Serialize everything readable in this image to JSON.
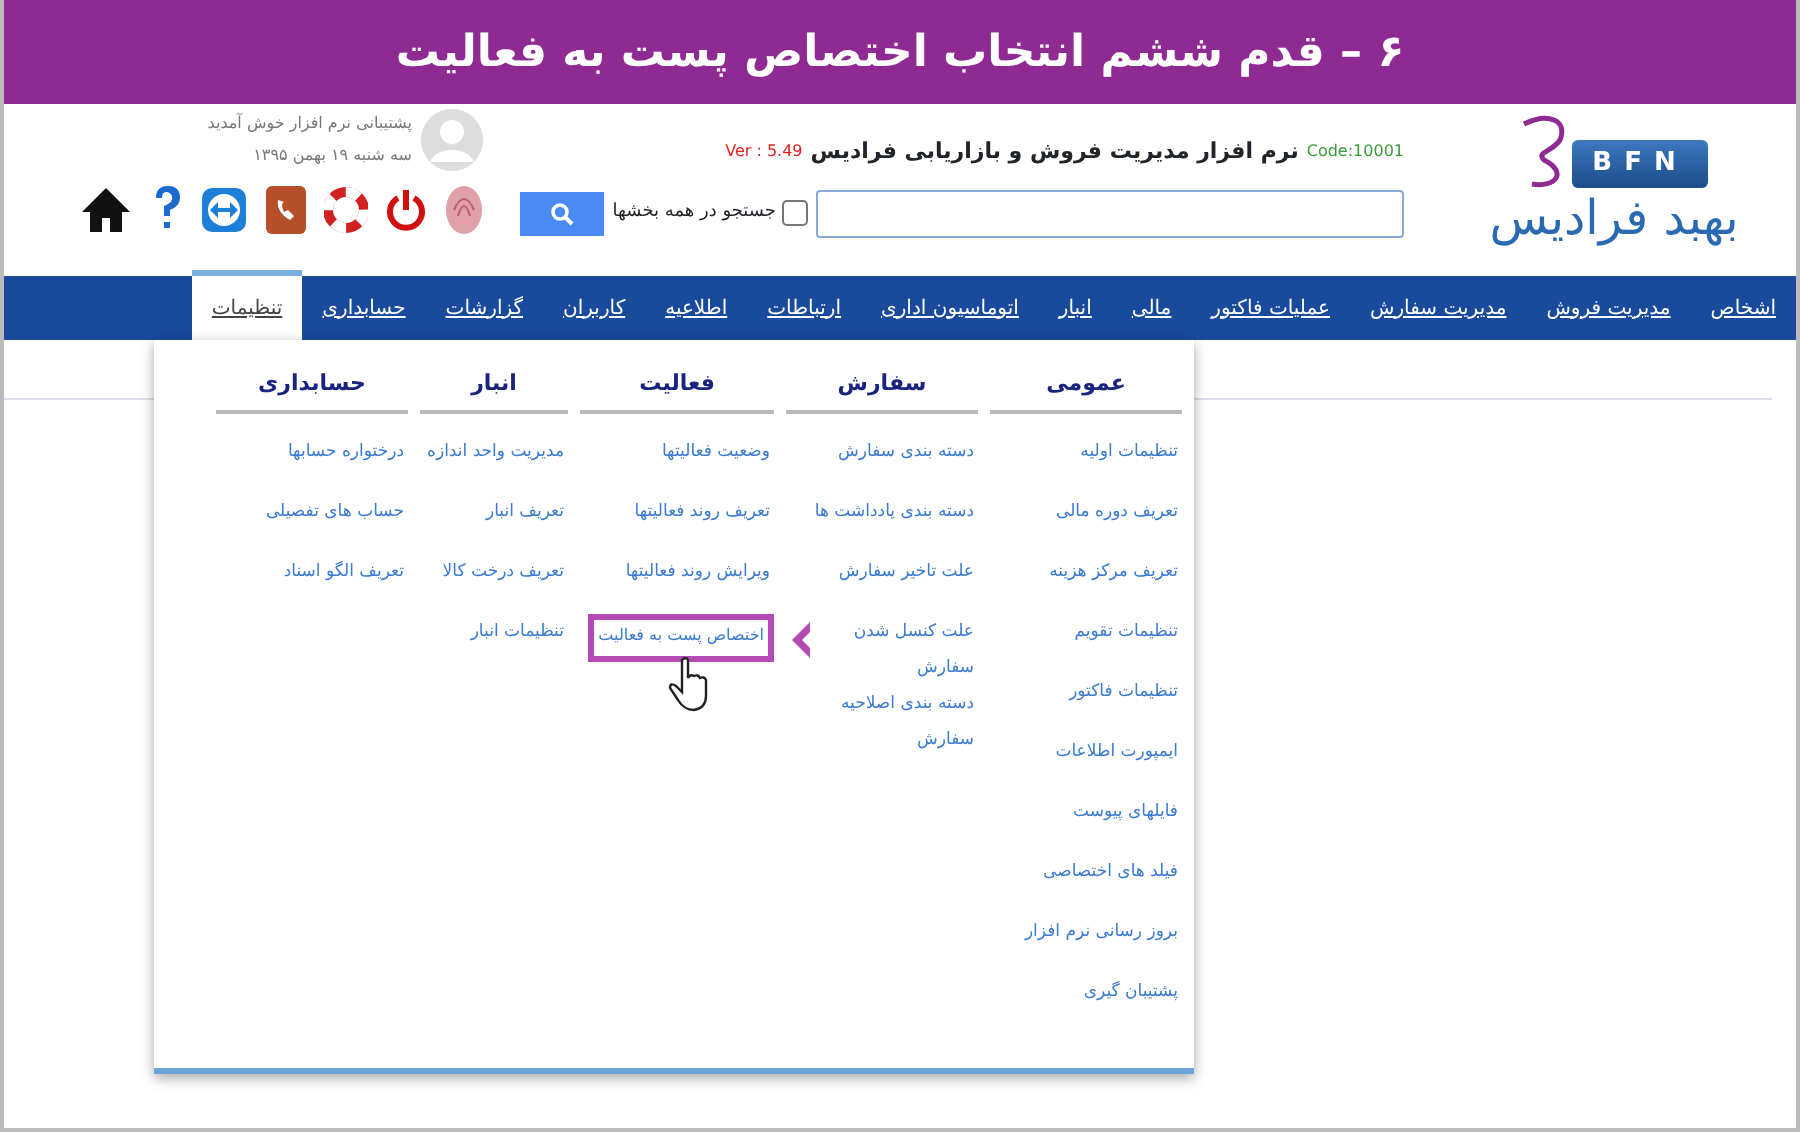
{
  "banner": {
    "title": "۶ – قدم ششم انتخاب اختصاص پست به فعالیت"
  },
  "header": {
    "logo_badge": "BFN",
    "logo_text": "بهبد فرادیس",
    "product_title": "نرم افزار مدیریت فروش و بازاریابی فرادیس",
    "code": "Code:10001",
    "version": "Ver : 5.49",
    "search": {
      "all_sections": {
        "label": "جستجو در همه بخشها",
        "checked": false
      }
    },
    "user": {
      "welcome": "پشتیبانی نرم افزار خوش آمدید",
      "date": "سه شنبه ۱۹ بهمن ۱۳۹۵"
    }
  },
  "nav": [
    {
      "label": "اشخاص",
      "selected": false
    },
    {
      "label": "مدیریت فروش",
      "selected": false
    },
    {
      "label": "مدیریت سفارش",
      "selected": false
    },
    {
      "label": "عملیات فاکتور",
      "selected": false
    },
    {
      "label": "مالی",
      "selected": false
    },
    {
      "label": "انبار",
      "selected": false
    },
    {
      "label": "اتوماسیون اداری",
      "selected": false
    },
    {
      "label": "ارتباطات",
      "selected": false
    },
    {
      "label": "اطلاعیه",
      "selected": false
    },
    {
      "label": "کاربران",
      "selected": false
    },
    {
      "label": "گزارشات",
      "selected": false
    },
    {
      "label": "حسابداری",
      "selected": false
    },
    {
      "label": "تنظیمات",
      "selected": true
    }
  ],
  "menu_columns": [
    {
      "title": "عمومی",
      "items": [
        {
          "label": "تنظیمات اولیه",
          "highlighted": false
        },
        {
          "label": "تعریف دوره مالی",
          "highlighted": false
        },
        {
          "label": "تعریف مرکز هزینه",
          "highlighted": false
        },
        {
          "label": "تنظیمات تقویم",
          "highlighted": false
        },
        {
          "label": "تنظیمات فاکتور",
          "highlighted": false
        },
        {
          "label": "ایمپورت اطلاعات",
          "highlighted": false
        },
        {
          "label": "فایلهای پیوست",
          "highlighted": false
        },
        {
          "label": "فیلد های اختصاصی",
          "highlighted": false
        },
        {
          "label": "بروز رسانی نرم افزار",
          "highlighted": false
        },
        {
          "label": "پشتیبان گیری",
          "highlighted": false
        }
      ]
    },
    {
      "title": "سفارش",
      "items": [
        {
          "label": "دسته بندی سفارش",
          "highlighted": false
        },
        {
          "label": "دسته بندی یادداشت ها",
          "highlighted": false
        },
        {
          "label": "علت تاخیر سفارش",
          "highlighted": false
        },
        {
          "label": "علت کنسل شدن سفارش",
          "highlighted": false
        },
        {
          "label": "دسته بندی اصلاحیه سفارش",
          "highlighted": false
        }
      ]
    },
    {
      "title": "فعالیت",
      "items": [
        {
          "label": "وضعیت فعالیتها",
          "highlighted": false
        },
        {
          "label": "تعریف روند فعالیتها",
          "highlighted": false
        },
        {
          "label": "ویرایش روند فعالیتها",
          "highlighted": false
        },
        {
          "label": "اختصاص پست به فعالیت",
          "highlighted": true
        }
      ]
    },
    {
      "title": "انبار",
      "items": [
        {
          "label": "مدیریت واحد اندازه",
          "highlighted": false
        },
        {
          "label": "تعریف انبار",
          "highlighted": false
        },
        {
          "label": "تعریف درخت کالا",
          "highlighted": false
        },
        {
          "label": "تنظیمات انبار",
          "highlighted": false
        }
      ]
    },
    {
      "title": "حسابداری",
      "items": [
        {
          "label": "درختواره حسابها",
          "highlighted": false
        },
        {
          "label": "حساب های تفصیلی",
          "highlighted": false
        },
        {
          "label": "تعریف الگو اسناد",
          "highlighted": false
        }
      ]
    }
  ]
}
